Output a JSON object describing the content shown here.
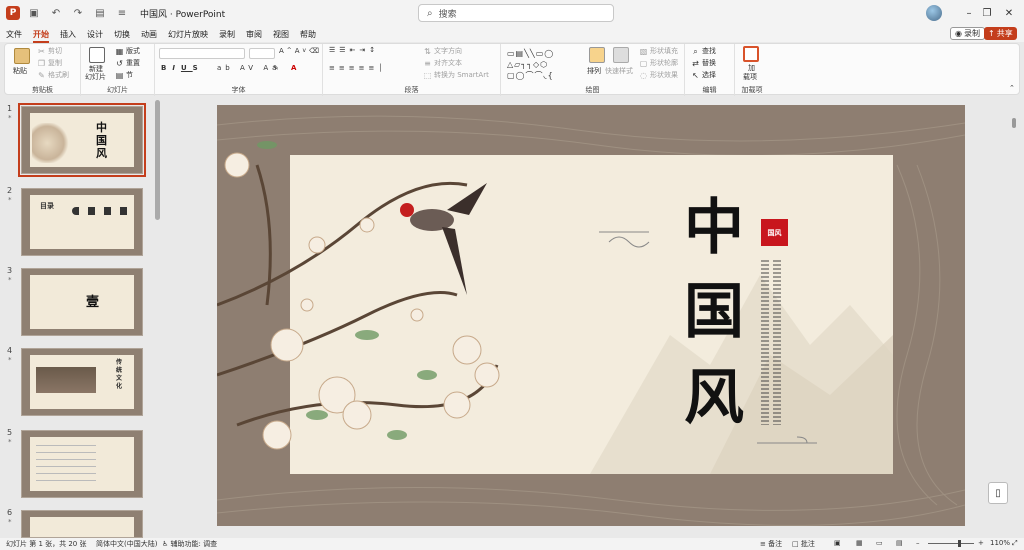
{
  "titlebar": {
    "doc_title": "中国风",
    "app_name": "PowerPoint",
    "search_placeholder": "搜索"
  },
  "menu": [
    "文件",
    "开始",
    "插入",
    "设计",
    "切换",
    "动画",
    "幻灯片放映",
    "录制",
    "审阅",
    "视图",
    "帮助"
  ],
  "menu_active": "开始",
  "record_label": "录制",
  "share_label": "共享",
  "ribbon": {
    "clipboard": {
      "paste": "粘贴",
      "cut": "剪切",
      "copy": "复制",
      "format_painter": "格式刷",
      "label": "剪贴板"
    },
    "slides": {
      "new_slide_1": "新建",
      "new_slide_2": "幻灯片",
      "layout": "版式",
      "reset": "重置",
      "section": "节",
      "label": "幻灯片"
    },
    "font": {
      "label": "字体"
    },
    "paragraph": {
      "text_direction": "文字方向",
      "align_text": "对齐文本",
      "smartart": "转换为 SmartArt",
      "label": "段落"
    },
    "drawing": {
      "arrange": "排列",
      "quick_styles": "快速样式",
      "fill": "形状填充",
      "outline": "形状轮廓",
      "effects": "形状效果",
      "label": "绘图"
    },
    "editing": {
      "find": "查找",
      "replace": "替换",
      "select": "选择",
      "label": "编辑"
    },
    "addins": {
      "addins_1": "加",
      "addins_2": "载项",
      "label": "加载项"
    }
  },
  "thumbnails": [
    {
      "num": "1",
      "title": "中国风"
    },
    {
      "num": "2",
      "title": "目录"
    },
    {
      "num": "3",
      "title": "壹"
    },
    {
      "num": "4",
      "title": "传统文化"
    },
    {
      "num": "5",
      "title": ""
    },
    {
      "num": "6",
      "title": ""
    }
  ],
  "slide": {
    "title_chars": [
      "中",
      "国",
      "风"
    ],
    "seal_text": "国风"
  },
  "statusbar": {
    "slide_info": "幻灯片 第 1 张，共 20 张",
    "language": "简体中文(中国大陆)",
    "accessibility": "辅助功能: 调查",
    "notes": "备注",
    "comments": "批注",
    "zoom": "110%"
  }
}
